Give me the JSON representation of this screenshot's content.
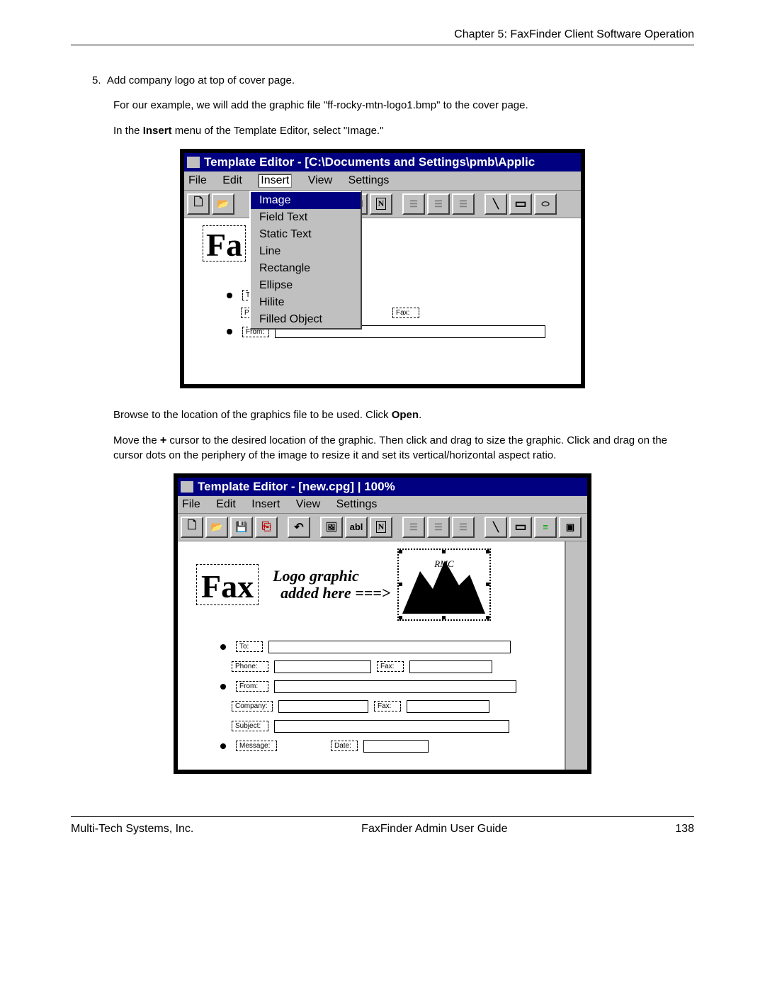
{
  "header": "Chapter 5: FaxFinder Client Software Operation",
  "step": {
    "num": "5.",
    "title": "Add company logo at top of cover page.",
    "para1": "For our example, we will add the graphic file \"ff-rocky-mtn-logo1.bmp\" to the cover page.",
    "para2_pre": "In the ",
    "para2_bold": "Insert",
    "para2_post": " menu of the Template Editor, select \"Image.\""
  },
  "shot1": {
    "title": "Template Editor - [C:\\Documents and Settings\\pmb\\Applic",
    "menus": [
      "File",
      "Edit",
      "Insert",
      "View",
      "Settings"
    ],
    "dropdown": [
      "Image",
      "Field Text",
      "Static Text",
      "Line",
      "Rectangle",
      "Ellipse",
      "Hilite",
      "Filled Object"
    ],
    "fax_label": "Fa",
    "fields": {
      "fax": "Fax:",
      "from": "From:"
    }
  },
  "mid": {
    "para_pre": "Browse to the location of the graphics file to be used.  Click ",
    "para_bold": "Open",
    "para_post": ".",
    "para2_pre": "Move the ",
    "para2_plus": "+",
    "para2_rest": " cursor to the desired location of the graphic.  Then click and drag to size the graphic.  Click and drag on the cursor dots on the periphery of the image to resize it and set its vertical/horizontal aspect ratio."
  },
  "shot2": {
    "title": "Template Editor - [new.cpg] | 100%",
    "menus": [
      "File",
      "Edit",
      "Insert",
      "View",
      "Settings"
    ],
    "fax_label": "Fax",
    "logo_label_line1": "Logo graphic",
    "logo_label_line2": "added here ===>",
    "logo_script": "RMC",
    "fields": {
      "to": "To:",
      "phone": "Phone:",
      "fax": "Fax:",
      "from": "From:",
      "company": "Company:",
      "fax2": "Fax:",
      "subject": "Subject:",
      "message": "Message:",
      "date": "Date:"
    }
  },
  "footer": {
    "left": "Multi-Tech Systems, Inc.",
    "center": "FaxFinder Admin User Guide",
    "right": "138"
  }
}
